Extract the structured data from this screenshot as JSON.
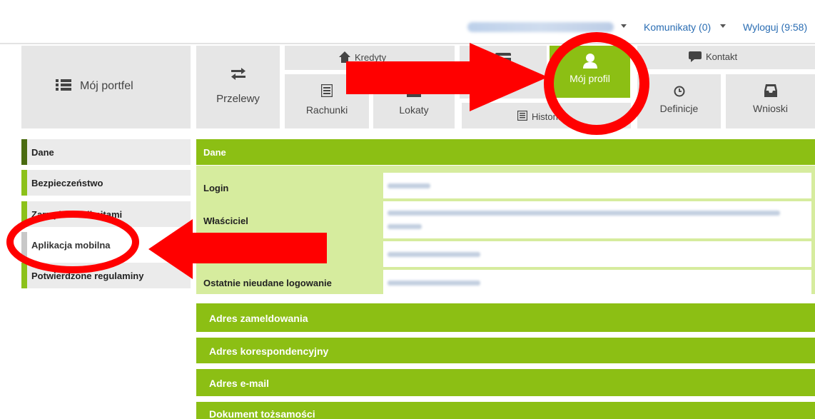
{
  "header": {
    "user_name_blurred": "",
    "messages_label": "Komunikaty (0)",
    "logout_label": "Wyloguj (9:58)"
  },
  "nav": {
    "portfolio": "Mój portfel",
    "transfers": "Przelewy",
    "credits": "Kredyty",
    "cards": "Karty",
    "profile": "Mój profil",
    "contact": "Kontakt",
    "accounts": "Rachunki",
    "deposits": "Lokaty",
    "history": "Historia",
    "definitions": "Definicje",
    "applications": "Wnioski"
  },
  "sidebar": {
    "items": [
      {
        "label": "Dane"
      },
      {
        "label": "Bezpieczeństwo"
      },
      {
        "label": "Zarządzanie limitami"
      },
      {
        "label": "Aplikacja mobilna"
      },
      {
        "label": "Potwierdzone regulaminy"
      }
    ]
  },
  "main": {
    "data_header": "Dane",
    "rows": [
      {
        "label": "Login",
        "value": ""
      },
      {
        "label": "Właściciel",
        "value": ""
      },
      {
        "label": "",
        "value": ""
      },
      {
        "label": "Ostatnie nieudane logowanie",
        "value": ""
      }
    ],
    "sections": [
      "Adres zameldowania",
      "Adres korespondencyjny",
      "Adres e-mail",
      "Dokument tożsamości"
    ]
  },
  "colors": {
    "accent_green": "#8cbf14",
    "light_green": "#d6ec9e",
    "annotation_red": "#ff0000",
    "link_blue": "#2a6db3"
  }
}
